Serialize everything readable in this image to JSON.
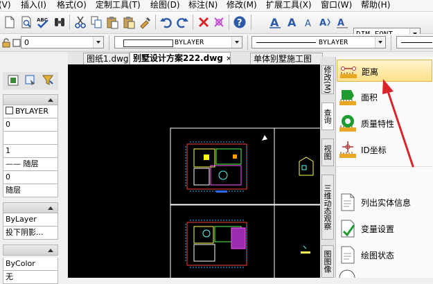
{
  "menu": {
    "items": [
      "(V)",
      "插入(I)",
      "格式(O)",
      "定制工具(T)",
      "绘图(D)",
      "标注(N)",
      "修改(M)",
      "扩展工具(X)",
      "窗口(W)",
      "帮助(H)"
    ]
  },
  "toolbar": {
    "text_style_combo": "DIM_FONT"
  },
  "props_toolbar": {
    "layer_value": "0",
    "color_value": "BYLAYER",
    "linetype_value": "BYLAYER"
  },
  "tabs": [
    {
      "label": "图纸1.dwg"
    },
    {
      "label": "别墅设计方案222.dwg"
    },
    {
      "label": "单体别墅施工图"
    }
  ],
  "properties": {
    "rows_general": [
      "BYLAYER",
      "0",
      "",
      "1",
      "—— 随层",
      "0",
      "随层"
    ],
    "rows_section2": [
      "ByLayer",
      "投下阴影..."
    ],
    "rows_section3": [
      "ByColor",
      "无"
    ]
  },
  "side_tabs": {
    "modify": "修改(M)",
    "query": "查询",
    "view": "视图",
    "orbit": "三维动态观察",
    "more": "图图像"
  },
  "query_commands": [
    {
      "label": "距离",
      "icon": "distance-icon"
    },
    {
      "label": "面积",
      "icon": "area-icon"
    },
    {
      "label": "质量特性",
      "icon": "mass-properties-icon"
    },
    {
      "label": "ID坐标",
      "icon": "id-point-icon"
    },
    {
      "label": "列出实体信息",
      "icon": "list-icon"
    },
    {
      "label": "变量设置",
      "icon": "setvar-icon"
    },
    {
      "label": "绘图状态",
      "icon": "status-icon"
    }
  ],
  "colors": {
    "annotation_arrow": "#d9252a",
    "selected_bg": "#ffe08a",
    "canvas_bg": "#000000"
  }
}
